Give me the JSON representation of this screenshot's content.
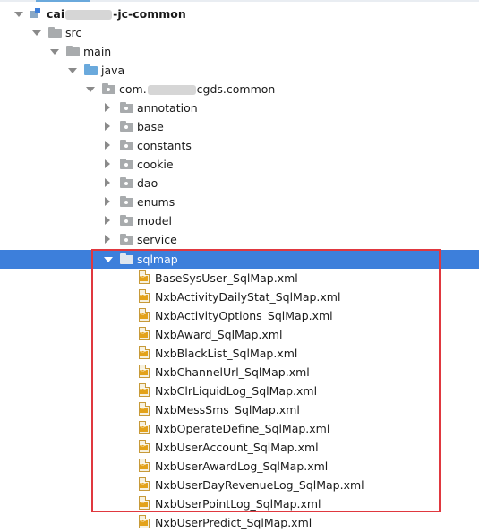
{
  "tree": {
    "module": {
      "prefix": "cai",
      "suffix": "-jc-common"
    },
    "src": "src",
    "main": "main",
    "java": "java",
    "package": {
      "prefix": "com.",
      "suffix": "cgds.common"
    },
    "folders": [
      "annotation",
      "base",
      "constants",
      "cookie",
      "dao",
      "enums",
      "model",
      "service"
    ],
    "selected_folder": "sqlmap",
    "files": [
      "BaseSysUser_SqlMap.xml",
      "NxbActivityDailyStat_SqlMap.xml",
      "NxbActivityOptions_SqlMap.xml",
      "NxbAward_SqlMap.xml",
      "NxbBlackList_SqlMap.xml",
      "NxbChannelUrl_SqlMap.xml",
      "NxbClrLiquidLog_SqlMap.xml",
      "NxbMessSms_SqlMap.xml",
      "NxbOperateDefine_SqlMap.xml",
      "NxbUserAccount_SqlMap.xml",
      "NxbUserAwardLog_SqlMap.xml",
      "NxbUserDayRevenueLog_SqlMap.xml",
      "NxbUserPointLog_SqlMap.xml",
      "NxbUserPredict_SqlMap.xml"
    ]
  },
  "colors": {
    "selection": "#3d7fdb",
    "highlight_box": "#e0383f",
    "folder": "#a8abad",
    "source_folder": "#6aa9dc"
  }
}
